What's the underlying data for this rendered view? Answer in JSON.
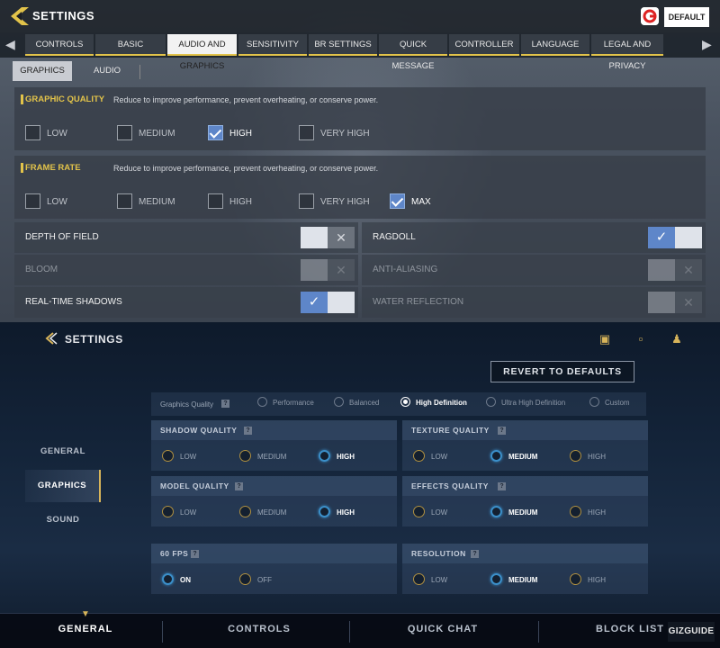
{
  "top": {
    "title": "SETTINGS",
    "default_button": "DEFAULT",
    "tabs": [
      "CONTROLS",
      "BASIC",
      "AUDIO AND GRAPHICS",
      "SENSITIVITY",
      "BR SETTINGS",
      "QUICK MESSAGE",
      "CONTROLLER",
      "LANGUAGE",
      "LEGAL AND PRIVACY"
    ],
    "active_tab": "AUDIO AND GRAPHICS",
    "subtabs": [
      "GRAPHICS",
      "AUDIO"
    ],
    "active_subtab": "GRAPHICS",
    "graphic_quality": {
      "title": "GRAPHIC QUALITY",
      "desc": "Reduce to improve performance, prevent overheating, or conserve power.",
      "options": [
        "LOW",
        "MEDIUM",
        "HIGH",
        "VERY HIGH"
      ],
      "selected": "HIGH"
    },
    "frame_rate": {
      "title": "FRAME RATE",
      "desc": "Reduce to improve performance, prevent overheating, or conserve power.",
      "options": [
        "LOW",
        "MEDIUM",
        "HIGH",
        "VERY HIGH",
        "MAX"
      ],
      "selected": "MAX"
    },
    "toggles": [
      {
        "label": "DEPTH OF FIELD",
        "state": "off",
        "enabled": true
      },
      {
        "label": "RAGDOLL",
        "state": "on",
        "enabled": true
      },
      {
        "label": "BLOOM",
        "state": "off",
        "enabled": false
      },
      {
        "label": "ANTI-ALIASING",
        "state": "off",
        "enabled": false
      },
      {
        "label": "REAL-TIME SHADOWS",
        "state": "on",
        "enabled": true
      },
      {
        "label": "WATER REFLECTION",
        "state": "off",
        "enabled": false
      }
    ]
  },
  "bottom": {
    "title": "SETTINGS",
    "revert_button": "REVERT TO DEFAULTS",
    "sidebar": [
      "GENERAL",
      "GRAPHICS",
      "SOUND"
    ],
    "active_sidebar": "GRAPHICS",
    "graphics_quality": {
      "label": "Graphics Quality",
      "help": "?",
      "options": [
        "Performance",
        "Balanced",
        "High Definition",
        "Ultra High Definition",
        "Custom"
      ],
      "selected": "High Definition"
    },
    "cards": [
      {
        "title": "SHADOW QUALITY",
        "options": [
          "LOW",
          "MEDIUM",
          "HIGH"
        ],
        "selected": "HIGH"
      },
      {
        "title": "TEXTURE QUALITY",
        "options": [
          "LOW",
          "MEDIUM",
          "HIGH"
        ],
        "selected": "MEDIUM"
      },
      {
        "title": "MODEL QUALITY",
        "options": [
          "LOW",
          "MEDIUM",
          "HIGH"
        ],
        "selected": "HIGH"
      },
      {
        "title": "EFFECTS QUALITY",
        "options": [
          "LOW",
          "MEDIUM",
          "HIGH"
        ],
        "selected": "MEDIUM"
      },
      {
        "title": "60 FPS",
        "options": [
          "ON",
          "OFF"
        ],
        "selected": "ON"
      },
      {
        "title": "RESOLUTION",
        "options": [
          "LOW",
          "MEDIUM",
          "HIGH"
        ],
        "selected": "MEDIUM"
      }
    ],
    "nav": [
      "GENERAL",
      "CONTROLS",
      "QUICK CHAT",
      "BLOCK LIST"
    ],
    "active_nav": "GENERAL",
    "watermark": "GIZGUIDE",
    "accent": "#d7b45a",
    "select_color": "#3b8fc9"
  }
}
